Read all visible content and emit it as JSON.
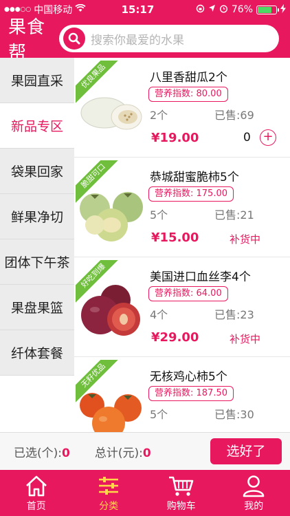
{
  "status_bar": {
    "carrier": "中国移动",
    "time": "15:17",
    "battery_percent": "76%",
    "battery_level": 0.76
  },
  "header": {
    "logo": "果食帮",
    "search_placeholder": "搜索你最爱的水果"
  },
  "sidebar": {
    "items": [
      {
        "label": "果园直采"
      },
      {
        "label": "新品专区"
      },
      {
        "label": "袋果回家"
      },
      {
        "label": "鲜果净切"
      },
      {
        "label": "团体下午茶"
      },
      {
        "label": "果盘果篮"
      },
      {
        "label": "纤体套餐"
      }
    ],
    "active_index": 1
  },
  "products": [
    {
      "ribbon": "优良果品",
      "name": "八里香甜瓜2个",
      "nutrition": "营养指数: 80.00",
      "unit": "2个",
      "sold": "已售:69",
      "price": "¥19.00",
      "qty": "0",
      "add": "+",
      "status": ""
    },
    {
      "ribbon": "脆甜可口",
      "name": "恭城甜蜜脆柿5个",
      "nutrition": "营养指数: 175.00",
      "unit": "5个",
      "sold": "已售:21",
      "price": "¥15.00",
      "qty": "",
      "add": "",
      "status": "补货中"
    },
    {
      "ribbon": "好吃到爆",
      "name": "美国进口血丝李4个",
      "nutrition": "营养指数: 64.00",
      "unit": "4个",
      "sold": "已售:23",
      "price": "¥29.00",
      "qty": "",
      "add": "",
      "status": "补货中"
    },
    {
      "ribbon": "无籽优品",
      "name": "无核鸡心柿5个",
      "nutrition": "营养指数: 187.50",
      "unit": "5个",
      "sold": "已售:30",
      "price": "",
      "qty": "",
      "add": "",
      "status": ""
    }
  ],
  "summary": {
    "selected_label": "已选(个):",
    "selected_value": "0",
    "total_label": "总计(元):",
    "total_value": "0",
    "confirm_button": "选好了"
  },
  "tabbar": {
    "items": [
      {
        "label": "首页",
        "icon": "home-icon"
      },
      {
        "label": "分类",
        "icon": "category-icon"
      },
      {
        "label": "购物车",
        "icon": "cart-icon"
      },
      {
        "label": "我的",
        "icon": "user-icon"
      }
    ],
    "active_index": 1
  },
  "colors": {
    "brand": "#e8185e",
    "ribbon": "#6fbe3c",
    "active_tab": "#ffd84a"
  }
}
